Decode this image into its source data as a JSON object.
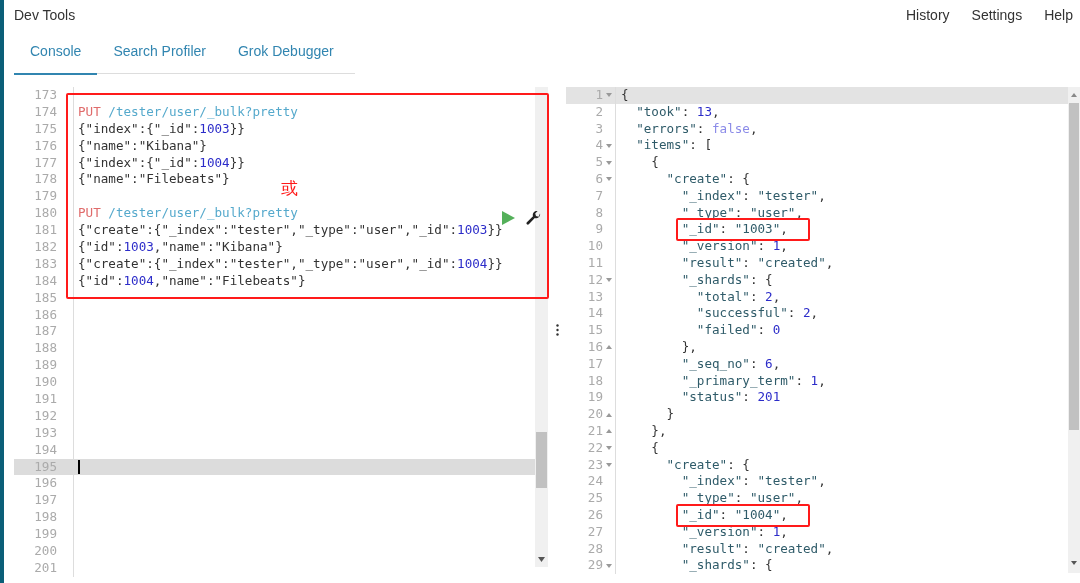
{
  "app": {
    "title": "Dev Tools",
    "menu": [
      "History",
      "Settings",
      "Help"
    ]
  },
  "tabs": [
    {
      "label": "Console",
      "selected": true
    },
    {
      "label": "Search Profiler",
      "selected": false
    },
    {
      "label": "Grok Debugger",
      "selected": false
    }
  ],
  "request_editor": {
    "lines": [
      {
        "number": "173",
        "active": false
      },
      {
        "number": "174",
        "active": false,
        "tokens": [
          {
            "kind": "method",
            "text": "PUT "
          },
          {
            "kind": "url",
            "text": "/tester/user/_bulk?pretty"
          }
        ]
      },
      {
        "number": "175",
        "active": false,
        "tokens": [
          {
            "kind": "plain",
            "text": "{\"index\":{\"_id\":"
          },
          {
            "kind": "number",
            "text": "1003"
          },
          {
            "kind": "plain",
            "text": "}}"
          }
        ]
      },
      {
        "number": "176",
        "active": false,
        "tokens": [
          {
            "kind": "plain",
            "text": "{\"name\":\"Kibana\"}"
          }
        ]
      },
      {
        "number": "177",
        "active": false,
        "tokens": [
          {
            "kind": "plain",
            "text": "{\"index\":{\"_id\":"
          },
          {
            "kind": "number",
            "text": "1004"
          },
          {
            "kind": "plain",
            "text": "}}"
          }
        ]
      },
      {
        "number": "178",
        "active": false,
        "tokens": [
          {
            "kind": "plain",
            "text": "{\"name\":\"Filebeats\"}"
          }
        ]
      },
      {
        "number": "179",
        "active": false
      },
      {
        "number": "180",
        "active": false,
        "tokens": [
          {
            "kind": "method",
            "text": "PUT "
          },
          {
            "kind": "url",
            "text": "/tester/user/_bulk?pretty"
          }
        ]
      },
      {
        "number": "181",
        "active": false,
        "tokens": [
          {
            "kind": "plain",
            "text": "{\"create\":{\"_index\":\"tester\",\"_type\":\"user\",\"_id\":"
          },
          {
            "kind": "number",
            "text": "1003"
          },
          {
            "kind": "plain",
            "text": "}}"
          }
        ]
      },
      {
        "number": "182",
        "active": false,
        "tokens": [
          {
            "kind": "plain",
            "text": "{\"id\":"
          },
          {
            "kind": "number",
            "text": "1003"
          },
          {
            "kind": "plain",
            "text": ",\"name\":\"Kibana\"}"
          }
        ]
      },
      {
        "number": "183",
        "active": false,
        "tokens": [
          {
            "kind": "plain",
            "text": "{\"create\":{\"_index\":\"tester\",\"_type\":\"user\",\"_id\":"
          },
          {
            "kind": "number",
            "text": "1004"
          },
          {
            "kind": "plain",
            "text": "}}"
          }
        ]
      },
      {
        "number": "184",
        "active": false,
        "tokens": [
          {
            "kind": "plain",
            "text": "{\"id\":"
          },
          {
            "kind": "number",
            "text": "1004"
          },
          {
            "kind": "plain",
            "text": ",\"name\":\"Filebeats\"}"
          }
        ]
      },
      {
        "number": "185",
        "active": false
      },
      {
        "number": "186",
        "active": false
      },
      {
        "number": "187",
        "active": false
      },
      {
        "number": "188",
        "active": false
      },
      {
        "number": "189",
        "active": false
      },
      {
        "number": "190",
        "active": false
      },
      {
        "number": "191",
        "active": false
      },
      {
        "number": "192",
        "active": false
      },
      {
        "number": "193",
        "active": false
      },
      {
        "number": "194",
        "active": false
      },
      {
        "number": "195",
        "active": true
      },
      {
        "number": "196",
        "active": false
      },
      {
        "number": "197",
        "active": false
      },
      {
        "number": "198",
        "active": false
      },
      {
        "number": "199",
        "active": false
      },
      {
        "number": "200",
        "active": false
      },
      {
        "number": "201",
        "active": false
      }
    ]
  },
  "response_editor": {
    "lines": [
      {
        "number": "1",
        "active": true,
        "kind": "block-start",
        "tokens": [
          {
            "kind": "plain",
            "text": "{"
          }
        ]
      },
      {
        "number": "2",
        "active": false,
        "kind": "line",
        "tokens": [
          {
            "kind": "key",
            "text": "  \"took\""
          },
          {
            "kind": "plain",
            "text": ": "
          },
          {
            "kind": "number",
            "text": "13"
          },
          {
            "kind": "plain",
            "text": ","
          }
        ]
      },
      {
        "number": "3",
        "active": false,
        "kind": "line",
        "tokens": [
          {
            "kind": "key",
            "text": "  \"errors\""
          },
          {
            "kind": "plain",
            "text": ": "
          },
          {
            "kind": "boolean",
            "text": "false"
          },
          {
            "kind": "plain",
            "text": ","
          }
        ]
      },
      {
        "number": "4",
        "active": false,
        "kind": "block-start",
        "tokens": [
          {
            "kind": "key",
            "text": "  \"items\""
          },
          {
            "kind": "plain",
            "text": ": ["
          }
        ]
      },
      {
        "number": "5",
        "active": false,
        "kind": "block-start",
        "tokens": [
          {
            "kind": "plain",
            "text": "    {"
          }
        ]
      },
      {
        "number": "6",
        "active": false,
        "kind": "block-start",
        "tokens": [
          {
            "kind": "key",
            "text": "      \"create\""
          },
          {
            "kind": "plain",
            "text": ": {"
          }
        ]
      },
      {
        "number": "7",
        "active": false,
        "kind": "line",
        "tokens": [
          {
            "kind": "key",
            "text": "        \"_index\""
          },
          {
            "kind": "plain",
            "text": ": "
          },
          {
            "kind": "key",
            "text": "\"tester\""
          },
          {
            "kind": "plain",
            "text": ","
          }
        ]
      },
      {
        "number": "8",
        "active": false,
        "kind": "line",
        "tokens": [
          {
            "kind": "key",
            "text": "        \"_type\""
          },
          {
            "kind": "plain",
            "text": ": "
          },
          {
            "kind": "key",
            "text": "\"user\""
          },
          {
            "kind": "plain",
            "text": ","
          }
        ]
      },
      {
        "number": "9",
        "active": false,
        "annotated": true,
        "kind": "line",
        "tokens": [
          {
            "kind": "key",
            "text": "        \"_id\""
          },
          {
            "kind": "plain",
            "text": ": "
          },
          {
            "kind": "key",
            "text": "\"1003\""
          },
          {
            "kind": "plain",
            "text": ","
          }
        ]
      },
      {
        "number": "10",
        "active": false,
        "kind": "line",
        "tokens": [
          {
            "kind": "key",
            "text": "        \"_version\""
          },
          {
            "kind": "plain",
            "text": ": "
          },
          {
            "kind": "number",
            "text": "1"
          },
          {
            "kind": "plain",
            "text": ","
          }
        ]
      },
      {
        "number": "11",
        "active": false,
        "kind": "line",
        "tokens": [
          {
            "kind": "key",
            "text": "        \"result\""
          },
          {
            "kind": "plain",
            "text": ": "
          },
          {
            "kind": "key",
            "text": "\"created\""
          },
          {
            "kind": "plain",
            "text": ","
          }
        ]
      },
      {
        "number": "12",
        "active": false,
        "kind": "block-start",
        "tokens": [
          {
            "kind": "key",
            "text": "        \"_shards\""
          },
          {
            "kind": "plain",
            "text": ": {"
          }
        ]
      },
      {
        "number": "13",
        "active": false,
        "kind": "line",
        "tokens": [
          {
            "kind": "key",
            "text": "          \"total\""
          },
          {
            "kind": "plain",
            "text": ": "
          },
          {
            "kind": "number",
            "text": "2"
          },
          {
            "kind": "plain",
            "text": ","
          }
        ]
      },
      {
        "number": "14",
        "active": false,
        "kind": "line",
        "tokens": [
          {
            "kind": "key",
            "text": "          \"successful\""
          },
          {
            "kind": "plain",
            "text": ": "
          },
          {
            "kind": "number",
            "text": "2"
          },
          {
            "kind": "plain",
            "text": ","
          }
        ]
      },
      {
        "number": "15",
        "active": false,
        "kind": "line",
        "tokens": [
          {
            "kind": "key",
            "text": "          \"failed\""
          },
          {
            "kind": "plain",
            "text": ": "
          },
          {
            "kind": "number",
            "text": "0"
          }
        ]
      },
      {
        "number": "16",
        "active": false,
        "kind": "block-end",
        "tokens": [
          {
            "kind": "plain",
            "text": "        },"
          }
        ]
      },
      {
        "number": "17",
        "active": false,
        "kind": "line",
        "tokens": [
          {
            "kind": "key",
            "text": "        \"_seq_no\""
          },
          {
            "kind": "plain",
            "text": ": "
          },
          {
            "kind": "number",
            "text": "6"
          },
          {
            "kind": "plain",
            "text": ","
          }
        ]
      },
      {
        "number": "18",
        "active": false,
        "kind": "line",
        "tokens": [
          {
            "kind": "key",
            "text": "        \"_primary_term\""
          },
          {
            "kind": "plain",
            "text": ": "
          },
          {
            "kind": "number",
            "text": "1"
          },
          {
            "kind": "plain",
            "text": ","
          }
        ]
      },
      {
        "number": "19",
        "active": false,
        "kind": "line",
        "tokens": [
          {
            "kind": "key",
            "text": "        \"status\""
          },
          {
            "kind": "plain",
            "text": ": "
          },
          {
            "kind": "number",
            "text": "201"
          }
        ]
      },
      {
        "number": "20",
        "active": false,
        "kind": "block-end",
        "tokens": [
          {
            "kind": "plain",
            "text": "      }"
          }
        ]
      },
      {
        "number": "21",
        "active": false,
        "kind": "block-end",
        "tokens": [
          {
            "kind": "plain",
            "text": "    },"
          }
        ]
      },
      {
        "number": "22",
        "active": false,
        "kind": "block-start",
        "tokens": [
          {
            "kind": "plain",
            "text": "    {"
          }
        ]
      },
      {
        "number": "23",
        "active": false,
        "kind": "block-start",
        "tokens": [
          {
            "kind": "key",
            "text": "      \"create\""
          },
          {
            "kind": "plain",
            "text": ": {"
          }
        ]
      },
      {
        "number": "24",
        "active": false,
        "kind": "line",
        "tokens": [
          {
            "kind": "key",
            "text": "        \"_index\""
          },
          {
            "kind": "plain",
            "text": ": "
          },
          {
            "kind": "key",
            "text": "\"tester\""
          },
          {
            "kind": "plain",
            "text": ","
          }
        ]
      },
      {
        "number": "25",
        "active": false,
        "kind": "line",
        "tokens": [
          {
            "kind": "key",
            "text": "        \"_type\""
          },
          {
            "kind": "plain",
            "text": ": "
          },
          {
            "kind": "key",
            "text": "\"user\""
          },
          {
            "kind": "plain",
            "text": ","
          }
        ]
      },
      {
        "number": "26",
        "active": false,
        "annotated": true,
        "kind": "line",
        "tokens": [
          {
            "kind": "key",
            "text": "        \"_id\""
          },
          {
            "kind": "plain",
            "text": ": "
          },
          {
            "kind": "key",
            "text": "\"1004\""
          },
          {
            "kind": "plain",
            "text": ","
          }
        ]
      },
      {
        "number": "27",
        "active": false,
        "kind": "line",
        "tokens": [
          {
            "kind": "key",
            "text": "        \"_version\""
          },
          {
            "kind": "plain",
            "text": ": "
          },
          {
            "kind": "number",
            "text": "1"
          },
          {
            "kind": "plain",
            "text": ","
          }
        ]
      },
      {
        "number": "28",
        "active": false,
        "kind": "line",
        "tokens": [
          {
            "kind": "key",
            "text": "        \"result\""
          },
          {
            "kind": "plain",
            "text": ": "
          },
          {
            "kind": "key",
            "text": "\"created\""
          },
          {
            "kind": "plain",
            "text": ","
          }
        ]
      },
      {
        "number": "29",
        "active": false,
        "kind": "block-start",
        "tokens": [
          {
            "kind": "key",
            "text": "        \"_shards\""
          },
          {
            "kind": "plain",
            "text": ": {"
          }
        ]
      }
    ]
  },
  "annotation": {
    "note": "或"
  }
}
